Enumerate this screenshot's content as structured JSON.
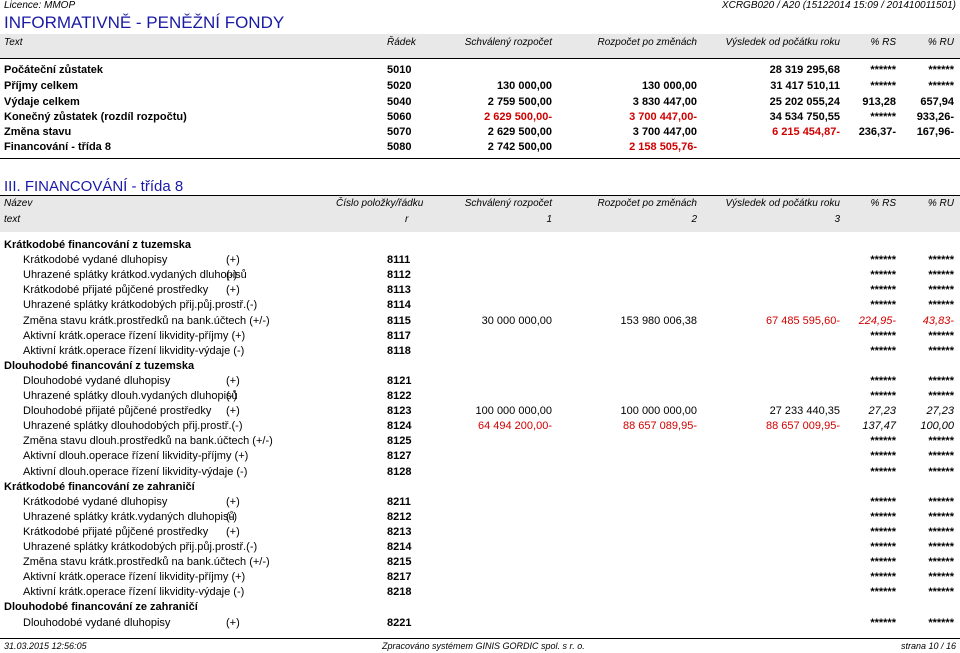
{
  "top": {
    "licence": "Licence: MMOP",
    "report_id": "XCRGB020 / A20  (15122014 15:09 / 201410011501)"
  },
  "title": "INFORMATIVNĚ - PENĚŽNÍ FONDY",
  "header1": {
    "text": "Text",
    "radek": "Řádek",
    "schvaleny": "Schválený rozpočet",
    "rozpocet": "Rozpočet po změnách",
    "vysledek": "Výsledek od počátku roku",
    "rs": "% RS",
    "ru": "% RU"
  },
  "summary_rows": [
    {
      "label": "Počáteční zůstatek",
      "code": "5010",
      "sch": "",
      "roz": "",
      "vys": "28 319 295,68",
      "rs": "******",
      "ru": "******",
      "red": {}
    },
    {
      "label": "Příjmy celkem",
      "code": "5020",
      "sch": "130 000,00",
      "roz": "130 000,00",
      "vys": "31 417 510,11",
      "rs": "******",
      "ru": "******",
      "red": {}
    },
    {
      "label": "Výdaje celkem",
      "code": "5040",
      "sch": "2 759 500,00",
      "roz": "3 830 447,00",
      "vys": "25 202 055,24",
      "rs": "913,28",
      "ru": "657,94",
      "red": {}
    },
    {
      "label": "Konečný zůstatek  (rozdíl rozpočtu)",
      "code": "5060",
      "sch": "2 629 500,00-",
      "roz": "3 700 447,00-",
      "vys": "34 534 750,55",
      "rs": "******",
      "ru": "933,26-",
      "red": {
        "sch": true,
        "roz": true
      }
    },
    {
      "label": "Změna stavu",
      "code": "5070",
      "sch": "2 629 500,00",
      "roz": "3 700 447,00",
      "vys": "6 215 454,87-",
      "rs": "236,37-",
      "ru": "167,96-",
      "red": {
        "vys": true
      }
    },
    {
      "label": "Financování  - třída 8",
      "code": "5080",
      "sch": "2 742 500,00",
      "roz": "2 158 505,76-",
      "vys": "",
      "rs": "",
      "ru": "",
      "red": {
        "roz": true
      }
    }
  ],
  "section_title": "III. FINANCOVÁNÍ - třída 8",
  "header2": {
    "nazev": "Název",
    "cislo": "Číslo položky/řádku",
    "schvaleny": "Schválený rozpočet",
    "rozpocet": "Rozpočet po změnách",
    "vysledek": "Výsledek od počátku roku",
    "rs": "% RS",
    "ru": "% RU",
    "text": "text",
    "r": "r",
    "n1": "1",
    "n2": "2",
    "n3": "3"
  },
  "detail_rows": [
    {
      "type": "group",
      "label": "Krátkodobé financování z tuzemska"
    },
    {
      "type": "item",
      "label": "Krátkodobé vydané dluhopisy",
      "sign": "(+)",
      "code": "8111",
      "sch": "",
      "roz": "",
      "vys": "",
      "rs": "******",
      "ru": "******"
    },
    {
      "type": "item",
      "label": "Uhrazené splátky krátkod.vydaných dluhopisů",
      "sign": "(-)",
      "code": "8112",
      "sch": "",
      "roz": "",
      "vys": "",
      "rs": "******",
      "ru": "******"
    },
    {
      "type": "item",
      "label": "Krátkodobé přijaté půjčené prostředky",
      "sign": "(+)",
      "code": "8113",
      "sch": "",
      "roz": "",
      "vys": "",
      "rs": "******",
      "ru": "******"
    },
    {
      "type": "item",
      "label": "Uhrazené splátky krátkodobých přij.půj.prostř.(-)",
      "sign": "",
      "code": "8114",
      "sch": "",
      "roz": "",
      "vys": "",
      "rs": "******",
      "ru": "******"
    },
    {
      "type": "item",
      "label": "Změna stavu krátk.prostředků na bank.účtech (+/-)",
      "sign": "",
      "code": "8115",
      "sch": "30 000 000,00",
      "roz": "153 980 006,38",
      "vys": "67 485 595,60-",
      "rs": "224,95-",
      "ru": "43,83-",
      "red": {
        "vys": true,
        "rs": true,
        "ru": true
      }
    },
    {
      "type": "item",
      "label": "Aktivní krátk.operace řízení likvidity-příjmy (+)",
      "sign": "",
      "code": "8117",
      "sch": "",
      "roz": "",
      "vys": "",
      "rs": "******",
      "ru": "******"
    },
    {
      "type": "item",
      "label": "Aktivní krátk.operace řízení likvidity-výdaje (-)",
      "sign": "",
      "code": "8118",
      "sch": "",
      "roz": "",
      "vys": "",
      "rs": "******",
      "ru": "******"
    },
    {
      "type": "group",
      "label": "Dlouhodobé financování z tuzemska"
    },
    {
      "type": "item",
      "label": "Dlouhodobé vydané dluhopisy",
      "sign": "(+)",
      "code": "8121",
      "sch": "",
      "roz": "",
      "vys": "",
      "rs": "******",
      "ru": "******"
    },
    {
      "type": "item",
      "label": "Uhrazené splátky dlouh.vydaných dluhopisů",
      "sign": "(-)",
      "code": "8122",
      "sch": "",
      "roz": "",
      "vys": "",
      "rs": "******",
      "ru": "******"
    },
    {
      "type": "item",
      "label": "Dlouhodobé přijaté půjčené prostředky",
      "sign": "(+)",
      "code": "8123",
      "sch": "100 000 000,00",
      "roz": "100 000 000,00",
      "vys": "27 233 440,35",
      "rs": "27,23",
      "ru": "27,23"
    },
    {
      "type": "item",
      "label": "Uhrazené splátky dlouhodobých přij.prostř.(-)",
      "sign": "",
      "code": "8124",
      "sch": "64 494 200,00-",
      "roz": "88 657 089,95-",
      "vys": "88 657 009,95-",
      "rs": "137,47",
      "ru": "100,00",
      "red": {
        "sch": true,
        "roz": true,
        "vys": true
      }
    },
    {
      "type": "item",
      "label": "Změna stavu dlouh.prostředků na bank.účtech (+/-)",
      "sign": "",
      "code": "8125",
      "sch": "",
      "roz": "",
      "vys": "",
      "rs": "******",
      "ru": "******"
    },
    {
      "type": "item",
      "label": "Aktivní dlouh.operace řízení likvidity-příjmy (+)",
      "sign": "",
      "code": "8127",
      "sch": "",
      "roz": "",
      "vys": "",
      "rs": "******",
      "ru": "******"
    },
    {
      "type": "item",
      "label": "Aktivní dlouh.operace řízení likvidity-výdaje (-)",
      "sign": "",
      "code": "8128",
      "sch": "",
      "roz": "",
      "vys": "",
      "rs": "******",
      "ru": "******"
    },
    {
      "type": "group",
      "label": "Krátkodobé financování ze zahraničí"
    },
    {
      "type": "item",
      "label": "Krátkodobé vydané dluhopisy",
      "sign": "(+)",
      "code": "8211",
      "sch": "",
      "roz": "",
      "vys": "",
      "rs": "******",
      "ru": "******"
    },
    {
      "type": "item",
      "label": "Uhrazené splátky krátk.vydaných dluhopisů",
      "sign": "(-)",
      "code": "8212",
      "sch": "",
      "roz": "",
      "vys": "",
      "rs": "******",
      "ru": "******"
    },
    {
      "type": "item",
      "label": "Krátkodobé přijaté půjčené prostředky",
      "sign": "(+)",
      "code": "8213",
      "sch": "",
      "roz": "",
      "vys": "",
      "rs": "******",
      "ru": "******"
    },
    {
      "type": "item",
      "label": "Uhrazené splátky krátkodobých přij.půj.prostř.(-)",
      "sign": "",
      "code": "8214",
      "sch": "",
      "roz": "",
      "vys": "",
      "rs": "******",
      "ru": "******"
    },
    {
      "type": "item",
      "label": "Změna stavu krátk.prostředků na bank.účtech (+/-)",
      "sign": "",
      "code": "8215",
      "sch": "",
      "roz": "",
      "vys": "",
      "rs": "******",
      "ru": "******"
    },
    {
      "type": "item",
      "label": "Aktivní krátk.operace řízení likvidity-příjmy (+)",
      "sign": "",
      "code": "8217",
      "sch": "",
      "roz": "",
      "vys": "",
      "rs": "******",
      "ru": "******"
    },
    {
      "type": "item",
      "label": "Aktivní krátk.operace řízení likvidity-výdaje (-)",
      "sign": "",
      "code": "8218",
      "sch": "",
      "roz": "",
      "vys": "",
      "rs": "******",
      "ru": "******"
    },
    {
      "type": "group",
      "label": "Dlouhodobé financování ze zahraničí"
    },
    {
      "type": "item",
      "label": "Dlouhodobé vydané dluhopisy",
      "sign": "(+)",
      "code": "8221",
      "sch": "",
      "roz": "",
      "vys": "",
      "rs": "******",
      "ru": "******"
    }
  ],
  "footer": {
    "date": "31.03.2015 12:56:05",
    "system": "Zpracováno systémem  GINIS GORDIC spol. s  r. o.",
    "page": "strana 10 / 16"
  }
}
